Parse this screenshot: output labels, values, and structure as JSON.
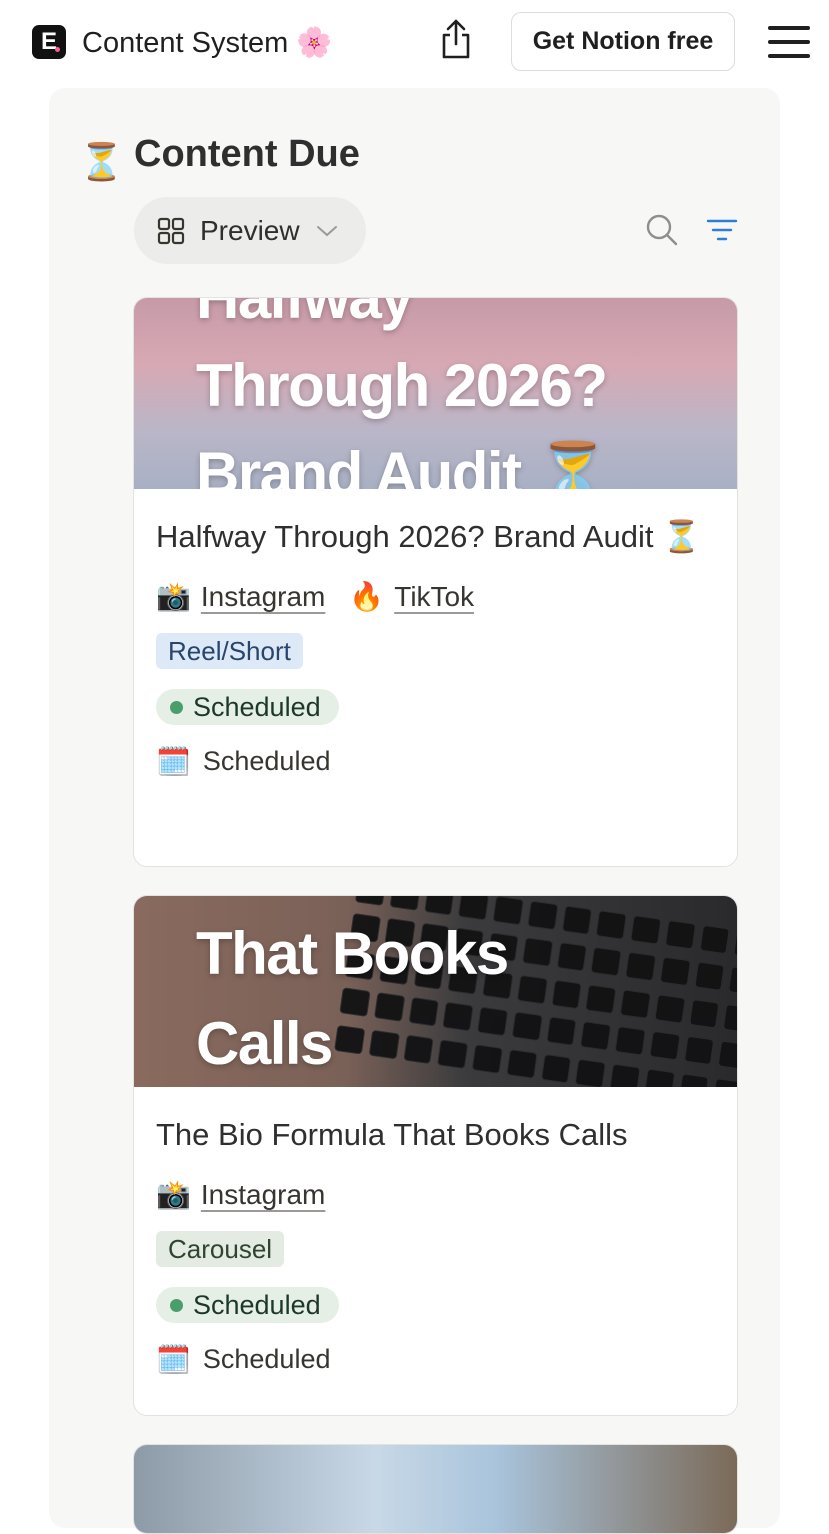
{
  "header": {
    "logo_letter": "E",
    "site_title": "Content System 🌸",
    "share_icon": "share-icon",
    "cta_label": "Get Notion free",
    "menu_icon": "hamburger-menu-icon"
  },
  "database": {
    "icon": "⏳",
    "title": "Content Due",
    "view": {
      "icon": "gallery-grid-icon",
      "label": "Preview",
      "chevron": "chevron-down-icon"
    },
    "tools": [
      "search-icon",
      "filter-icon"
    ]
  },
  "cards": [
    {
      "cover_lines": [
        "Halfway",
        "Through 2026?",
        "Brand Audit ⏳"
      ],
      "title": "Halfway Through 2026? Brand Audit ⏳",
      "platforms": [
        {
          "emoji": "📸",
          "label": "Instagram"
        },
        {
          "emoji": "🔥",
          "label": "TikTok"
        }
      ],
      "format": "Reel/Short",
      "status": "Scheduled",
      "date_emoji": "🗓️",
      "date_label": "Scheduled"
    },
    {
      "cover_lines": [
        "That Books",
        "Calls"
      ],
      "title": "The Bio Formula That Books Calls",
      "platforms": [
        {
          "emoji": "📸",
          "label": "Instagram"
        }
      ],
      "format": "Carousel",
      "status": "Scheduled",
      "date_emoji": "🗓️",
      "date_label": "Scheduled"
    }
  ],
  "colors": {
    "format_reel_bg": "#dde9f7",
    "format_carousel_bg": "#e3ebe3",
    "status_bg": "#e6efe6",
    "status_dot": "#4a9e6c",
    "filter_accent": "#2d7ed6"
  }
}
